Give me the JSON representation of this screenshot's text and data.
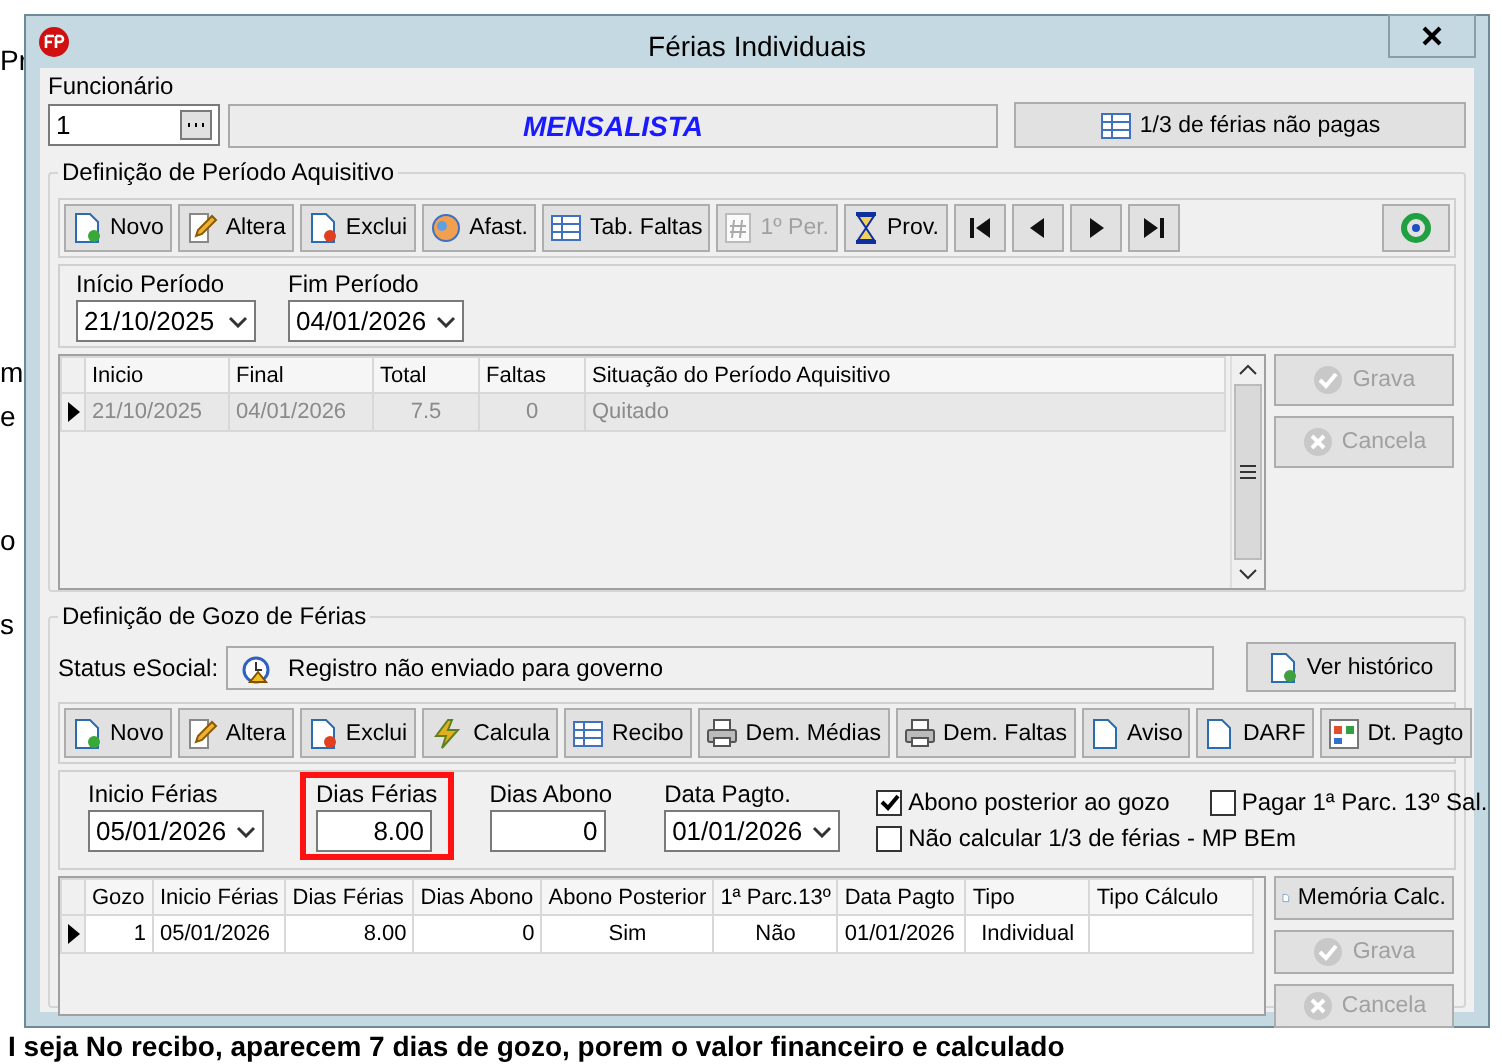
{
  "background": {
    "fragments": [
      "Pr",
      "m",
      "e",
      "o",
      "s"
    ],
    "caption": "I seja No recibo, aparecem 7 dias de gozo, porem o valor financeiro e calculado"
  },
  "window": {
    "title": "Férias Individuais"
  },
  "employee": {
    "label": "Funcionário",
    "value": "1",
    "name": "MENSALISTA",
    "button": "1/3 de férias não pagas"
  },
  "acquisition": {
    "title": "Definição de Período Aquisitivo",
    "toolbar": [
      {
        "label": "Novo",
        "disabled": false
      },
      {
        "label": "Altera",
        "disabled": false
      },
      {
        "label": "Exclui",
        "disabled": false
      },
      {
        "label": "Afast.",
        "disabled": false
      },
      {
        "label": "Tab. Faltas",
        "disabled": false
      },
      {
        "label": "1º Per.",
        "disabled": true
      },
      {
        "label": "Prov.",
        "disabled": false
      }
    ],
    "start": {
      "label": "Início Período",
      "value": "21/10/2025"
    },
    "end": {
      "label": "Fim Período",
      "value": "04/01/2026"
    },
    "table": {
      "columns": [
        "Inicio",
        "Final",
        "Total",
        "Faltas",
        "Situação do Período Aquisitivo"
      ],
      "rows": [
        {
          "selected": true,
          "disabled": true,
          "cells": [
            "21/10/2025",
            "04/01/2026",
            "7.5",
            "0",
            "Quitado"
          ]
        }
      ]
    },
    "buttons": [
      {
        "label": "Grava",
        "disabled": true
      },
      {
        "label": "Cancela",
        "disabled": true
      }
    ]
  },
  "enjoyment": {
    "title": "Definição de Gozo de Férias",
    "status_label": "Status eSocial:",
    "status": "Registro não enviado para governo",
    "history_button": "Ver histórico",
    "toolbar": [
      {
        "label": "Novo",
        "disabled": false
      },
      {
        "label": "Altera",
        "disabled": false
      },
      {
        "label": "Exclui",
        "disabled": false
      },
      {
        "label": "Calcula",
        "disabled": false
      },
      {
        "label": "Recibo",
        "disabled": false
      },
      {
        "label": "Dem. Médias",
        "disabled": false
      },
      {
        "label": "Dem. Faltas",
        "disabled": false
      },
      {
        "label": "Aviso",
        "disabled": false
      },
      {
        "label": "DARF",
        "disabled": false
      },
      {
        "label": "Dt. Pagto",
        "disabled": false
      }
    ],
    "fields": [
      {
        "kind": "select",
        "label": "Inicio Férias",
        "value": "05/01/2026",
        "highlighted": false
      },
      {
        "kind": "number",
        "label": "Dias Férias",
        "value": "8.00",
        "highlighted": true
      },
      {
        "kind": "number",
        "label": "Dias Abono",
        "value": "0",
        "highlighted": false
      },
      {
        "kind": "select",
        "label": "Data Pagto.",
        "value": "01/01/2026",
        "highlighted": false
      }
    ],
    "checks": [
      {
        "label": "Abono posterior ao gozo",
        "checked": true
      },
      {
        "label": "Pagar 1ª Parc. 13º Sal.",
        "checked": false
      },
      {
        "label": "Não calcular 1/3 de férias - MP BEm",
        "checked": false
      }
    ],
    "table": {
      "columns": [
        "Gozo",
        "Inicio Férias",
        "Dias Férias",
        "Dias Abono",
        "Abono Posterior",
        "1ª Parc.13º",
        "Data Pagto",
        "Tipo",
        "Tipo Cálculo"
      ],
      "rows": [
        {
          "selected": true,
          "disabled": false,
          "cells": [
            "1",
            "05/01/2026",
            "8.00",
            "0",
            "Sim",
            "Não",
            "01/01/2026",
            "Individual",
            ""
          ]
        }
      ]
    },
    "buttons": [
      {
        "label": "Memória Calc.",
        "disabled": false
      },
      {
        "label": "Grava",
        "disabled": true
      },
      {
        "label": "Cancela",
        "disabled": true
      }
    ]
  }
}
